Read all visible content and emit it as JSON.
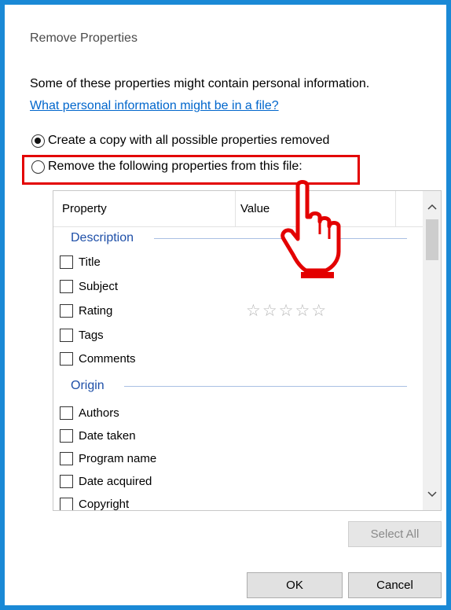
{
  "window": {
    "title": "Remove Properties"
  },
  "intro": {
    "text": "Some of these properties might contain personal information.",
    "link": "What personal information might be in a file?"
  },
  "options": {
    "copy_label": "Create a copy with all possible properties removed",
    "remove_label": "Remove the following properties from this file:",
    "selected": "copy"
  },
  "list": {
    "columns": [
      "Property",
      "Value"
    ],
    "groups": [
      {
        "name": "Description",
        "items": [
          "Title",
          "Subject",
          "Rating",
          "Tags",
          "Comments"
        ]
      },
      {
        "name": "Origin",
        "items": [
          "Authors",
          "Date taken",
          "Program name",
          "Date acquired",
          "Copyright"
        ]
      }
    ],
    "rating_stars": "☆☆☆☆☆"
  },
  "buttons": {
    "select_all": "Select All",
    "ok": "OK",
    "cancel": "Cancel"
  },
  "colors": {
    "window_border": "#1a89d6",
    "link": "#0066cc",
    "group_header": "#1e4fa8",
    "highlight": "#e30000"
  },
  "icons": {
    "pointer": "hand-pointer-icon"
  }
}
